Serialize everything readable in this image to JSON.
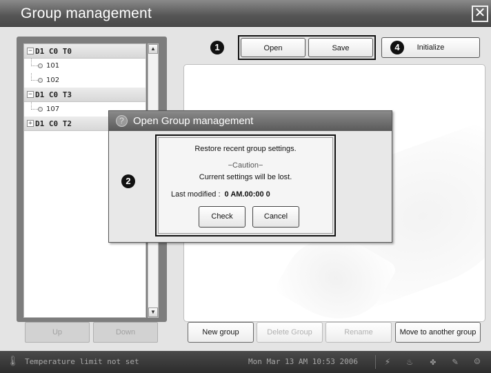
{
  "window": {
    "title": "Group management",
    "close_glyph": "✕"
  },
  "tree": {
    "groups": [
      {
        "label": "D1 C0 T0",
        "expander": "−",
        "children": [
          "101",
          "102"
        ]
      },
      {
        "label": "D1 C0 T3",
        "expander": "−",
        "children": [
          "107"
        ]
      },
      {
        "label": "D1 C0 T2",
        "expander": "+",
        "children": []
      }
    ],
    "scroll_up": "▲",
    "scroll_down": "▼"
  },
  "nav": {
    "up": "Up",
    "down": "Down"
  },
  "toolbar": {
    "open": "Open",
    "save": "Save",
    "initialize": "Initialize"
  },
  "callouts": {
    "one": "1",
    "two": "2",
    "four": "4"
  },
  "bottom": {
    "new_group": "New group",
    "delete_group": "Delete Group",
    "rename": "Rename",
    "move": "Move to another group"
  },
  "dialog": {
    "title": "Open Group management",
    "help_glyph": "?",
    "line1": "Restore recent group settings.",
    "caution": "−Caution−",
    "line2": "Current settings will be lost.",
    "last_modified_label": "Last modified :",
    "last_modified_value": "0 AM.00:00 0",
    "check": "Check",
    "cancel": "Cancel"
  },
  "status": {
    "thermo_icon": "thermometer-icon",
    "text": "Temperature limit not set",
    "datetime": "Mon Mar 13 AM 10:53 2006",
    "icons": [
      "lightning-icon",
      "flame-icon",
      "fan-icon",
      "broom-icon",
      "user-icon"
    ]
  },
  "colors": {
    "titlebar": "#555555",
    "statusbar": "#2c2c2c",
    "callout": "#111111"
  }
}
